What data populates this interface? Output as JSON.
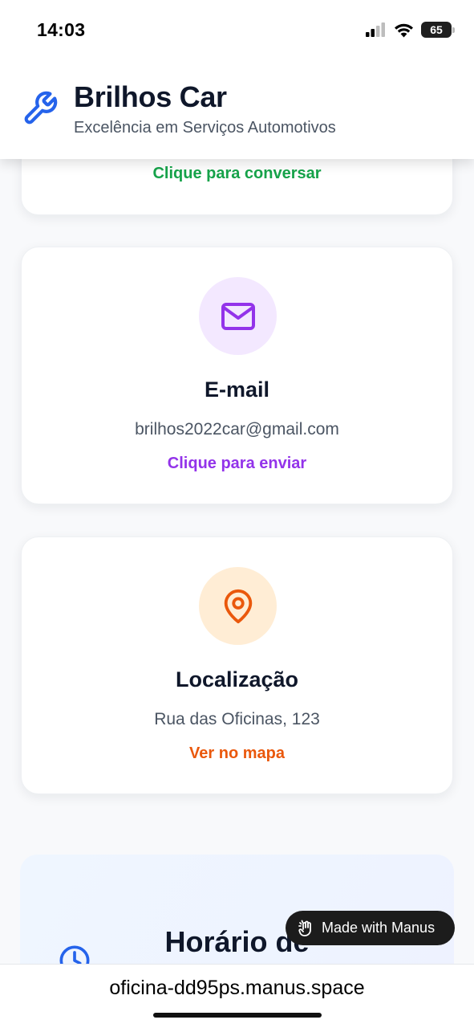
{
  "status_bar": {
    "time": "14:03",
    "battery_level": "65",
    "icons": [
      "cellular-signal-icon",
      "wifi-icon",
      "battery-icon"
    ]
  },
  "header": {
    "logo_icon": "wrench-icon",
    "title": "Brilhos Car",
    "subtitle": "Excelência em Serviços Automotivos"
  },
  "contacts": {
    "top_card": {
      "link_label": "Clique para conversar",
      "link_color": "#16a34a"
    },
    "email": {
      "icon": "mail-icon",
      "title": "E-mail",
      "value": "brilhos2022car@gmail.com",
      "link_label": "Clique para enviar",
      "accent_color": "#9333ea"
    },
    "location": {
      "icon": "map-pin-icon",
      "title": "Localização",
      "value": "Rua das Oficinas, 123",
      "link_label": "Ver no mapa",
      "accent_color": "#ea580c"
    }
  },
  "hours": {
    "icon": "clock-icon",
    "title": "Horário de"
  },
  "badge": {
    "label": "Made with Manus"
  },
  "browser": {
    "url": "oficina-dd95ps.manus.space"
  }
}
